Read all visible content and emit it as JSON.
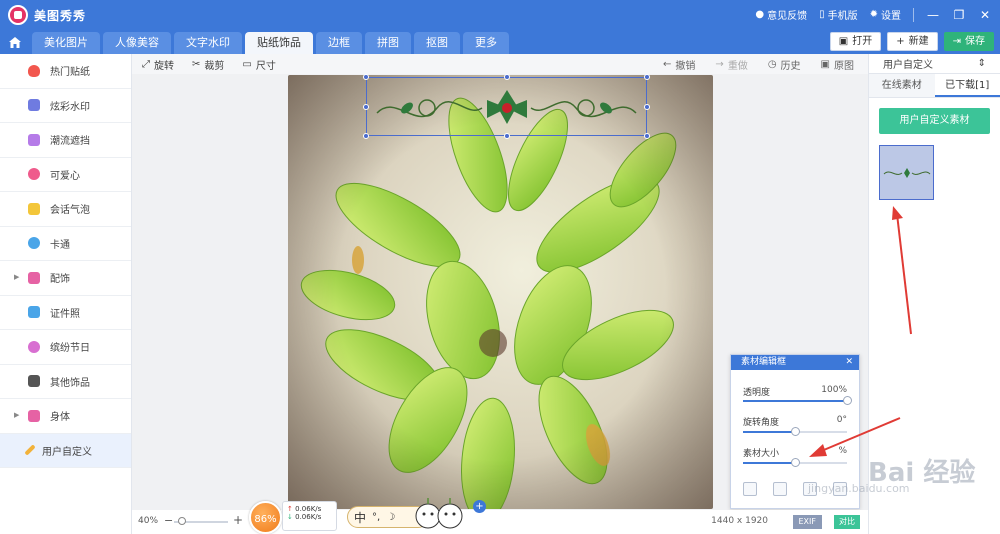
{
  "titlebar": {
    "app_name": "美图秀秀",
    "feedback": "意见反馈",
    "phone_version": "手机版",
    "settings": "设置"
  },
  "tabs": [
    {
      "label": "美化图片"
    },
    {
      "label": "人像美容"
    },
    {
      "label": "文字水印"
    },
    {
      "label": "贴纸饰品"
    },
    {
      "label": "边框"
    },
    {
      "label": "拼图"
    },
    {
      "label": "抠图"
    },
    {
      "label": "更多"
    }
  ],
  "actions": {
    "open": "打开",
    "new": "新建",
    "save": "保存"
  },
  "sidebar": {
    "items": [
      {
        "label": "热门贴纸",
        "icon": "fire-icon",
        "color": "#f2574e"
      },
      {
        "label": "炫彩水印",
        "icon": "watermark-icon",
        "color": "#6f7be0"
      },
      {
        "label": "潮流遮挡",
        "icon": "mask-icon",
        "color": "#b57be8"
      },
      {
        "label": "可爱心",
        "icon": "heart-icon",
        "color": "#ef5b8c"
      },
      {
        "label": "会话气泡",
        "icon": "chat-bubble-icon",
        "color": "#f3c63a"
      },
      {
        "label": "卡通",
        "icon": "cartoon-bear-icon",
        "color": "#4aa5e8"
      },
      {
        "label": "配饰",
        "icon": "bow-icon",
        "color": "#e662a4"
      },
      {
        "label": "证件照",
        "icon": "id-photo-icon",
        "color": "#4aa5e8"
      },
      {
        "label": "缤纷节日",
        "icon": "balloon-icon",
        "color": "#d86fd1"
      },
      {
        "label": "其他饰品",
        "icon": "grid-icon",
        "color": "#555555"
      },
      {
        "label": "身体",
        "icon": "bow-icon",
        "color": "#e662a4"
      },
      {
        "label": "用户自定义",
        "icon": "pencil-icon",
        "color": "#f2b23a"
      }
    ]
  },
  "canvas_toolbar": {
    "rotate": "旋转",
    "crop": "裁剪",
    "size": "尺寸",
    "undo": "撤销",
    "redo": "重做",
    "history": "历史",
    "original": "原图"
  },
  "right_panel": {
    "category_select": "用户自定义",
    "tab_online": "在线素材",
    "tab_downloaded": "已下载[1]",
    "custom_button": "用户自定义素材"
  },
  "editor": {
    "title": "素材编辑框",
    "opacity_label": "透明度",
    "opacity_value": "100%",
    "opacity_level": 1.0,
    "rotation_label": "旋转角度",
    "rotation_value": "0°",
    "rotation_level": 0.5,
    "size_label": "素材大小",
    "size_value": "%",
    "size_level": 0.5
  },
  "status": {
    "zoom": "40%",
    "zoom_level": 0.1,
    "perf": "86%",
    "net_up": "0.06K/s",
    "net_down": "0.06K/s",
    "ime_char": "中",
    "image_size": "1440 x 1920",
    "exif": "EXIF",
    "compare": "对比"
  },
  "watermark": {
    "brand": "Bai 经验",
    "url": "jingyan.baidu.com"
  }
}
